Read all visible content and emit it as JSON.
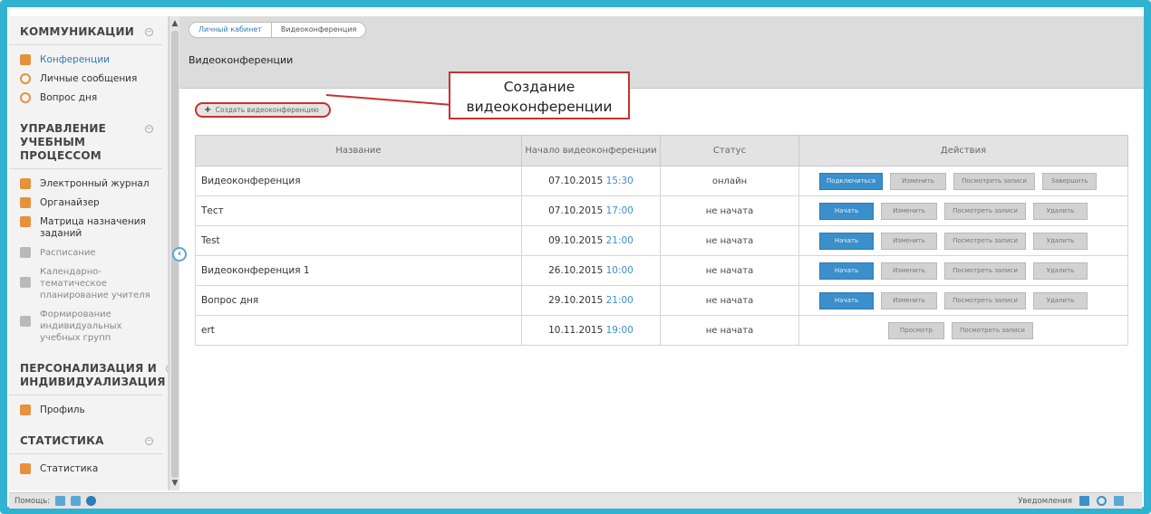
{
  "sidebar": {
    "sections": [
      {
        "title": "КОММУНИКАЦИИ",
        "items": [
          {
            "label": "Конференции",
            "active": true,
            "icon": "conference-icon"
          },
          {
            "label": "Личные сообщения",
            "icon": "messages-icon"
          },
          {
            "label": "Вопрос дня",
            "icon": "question-icon"
          }
        ]
      },
      {
        "title": "УПРАВЛЕНИЕ УЧЕБНЫМ ПРОЦЕССОМ",
        "items": [
          {
            "label": "Электронный журнал",
            "icon": "journal-icon"
          },
          {
            "label": "Органайзер",
            "icon": "organizer-icon"
          },
          {
            "label": "Матрица назначения заданий",
            "icon": "matrix-icon"
          },
          {
            "label": "Расписание",
            "icon": "schedule-icon"
          },
          {
            "label": "Календарно-тематическое планирование учителя",
            "icon": "calendar-plan-icon"
          },
          {
            "label": "Формирование индивидуальных учебных групп",
            "icon": "groups-icon"
          }
        ]
      },
      {
        "title": "ПЕРСОНАЛИЗАЦИЯ И ИНДИВИДУАЛИЗАЦИЯ",
        "items": [
          {
            "label": "Профиль",
            "icon": "profile-icon"
          }
        ]
      },
      {
        "title": "СТАТИСТИКА",
        "items": [
          {
            "label": "Статистика",
            "icon": "statistics-icon"
          }
        ]
      }
    ]
  },
  "breadcrumb": [
    "Личный кабинет",
    "Видеоконференция"
  ],
  "page_title": "Видеоконференции",
  "annotation": "Создание видеоконференции",
  "create_button": "Создать видеоконференцию",
  "table": {
    "headers": [
      "Название",
      "Начало видеоконференции",
      "Статус",
      "Действия"
    ],
    "rows": [
      {
        "name": "Видеоконференция",
        "date": "07.10.2015",
        "time": "15:30",
        "status": "онлайн",
        "actions": [
          "Подключиться",
          "Изменить",
          "Посмотреть записи",
          "Завершить"
        ]
      },
      {
        "name": "Тест",
        "date": "07.10.2015",
        "time": "17:00",
        "status": "не начата",
        "actions": [
          "Начать",
          "Изменить",
          "Посмотреть записи",
          "Удалить"
        ]
      },
      {
        "name": "Test",
        "date": "09.10.2015",
        "time": "21:00",
        "status": "не начата",
        "actions": [
          "Начать",
          "Изменить",
          "Посмотреть записи",
          "Удалить"
        ]
      },
      {
        "name": "Видеоконференция 1",
        "date": "26.10.2015",
        "time": "10:00",
        "status": "не начата",
        "actions": [
          "Начать",
          "Изменить",
          "Посмотреть записи",
          "Удалить"
        ]
      },
      {
        "name": "Вопрос дня",
        "date": "29.10.2015",
        "time": "21:00",
        "status": "не начата",
        "actions": [
          "Начать",
          "Изменить",
          "Посмотреть записи",
          "Удалить"
        ]
      },
      {
        "name": "ert",
        "date": "10.11.2015",
        "time": "19:00",
        "status": "не начата",
        "actions": [
          "Просмотр",
          "Посмотреть записи"
        ]
      }
    ]
  },
  "bottombar": {
    "help": "Помощь:",
    "notifications": "Уведомления"
  },
  "colors": {
    "frame": "#2fb3d0",
    "accent": "#3b8fca",
    "annotation": "#c8322e",
    "icon_orange": "#e8913c"
  }
}
